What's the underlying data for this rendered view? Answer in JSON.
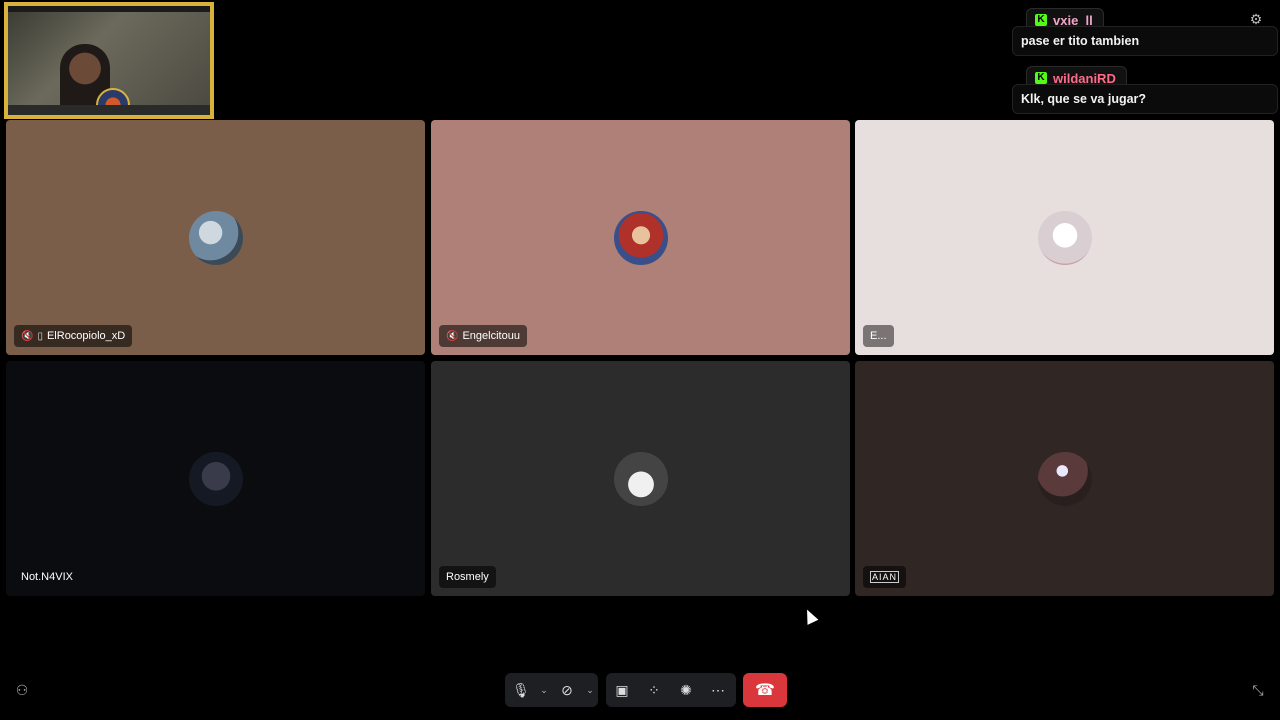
{
  "chat": {
    "messages": [
      {
        "user": "vxie_ll",
        "user_color": "#f0a6c8",
        "text": "pase er tito tambien",
        "platform_icon": "K"
      },
      {
        "user": "wildaniRD",
        "user_color": "#ff6b8a",
        "text": "Klk, que se va jugar?",
        "platform_icon": "K"
      }
    ],
    "settings_icon": "gear-icon"
  },
  "tiles": [
    {
      "name": "ElRocopiolo_xD",
      "bg": "#7a5e49",
      "avatar_color": "#9db6c8",
      "icons": [
        "mute-icon",
        "phone-icon"
      ]
    },
    {
      "name": "Engelcitouu",
      "bg": "#ae8077",
      "avatar_color": "#b0302a",
      "icons": [
        "mute-icon"
      ]
    },
    {
      "name": "E...",
      "bg": "#e6dfdd",
      "avatar_color": "#f2eeee",
      "icons": []
    },
    {
      "name": "Not.N4VIX",
      "bg": "#0b0c10",
      "avatar_color": "#1a2235",
      "icons": []
    },
    {
      "name": "Rosmely",
      "bg": "#2c2c2c",
      "avatar_color": "#cfcfcf",
      "icons": []
    },
    {
      "name": "AIAN",
      "bg": "#302724",
      "avatar_color": "#5a3a3a",
      "icons": []
    }
  ],
  "toolbar": {
    "mic_icon": "microphone-icon",
    "camera_icon": "camera-off-icon",
    "share_icon": "screen-share-icon",
    "activities_icon": "activities-icon",
    "soundboard_icon": "soundboard-icon",
    "more_icon": "more-icon",
    "hangup_icon": "hang-up-icon"
  },
  "colors": {
    "accent_red": "#da373c",
    "kick_green": "#53fc18",
    "frame_gold": "#d8b23a"
  }
}
